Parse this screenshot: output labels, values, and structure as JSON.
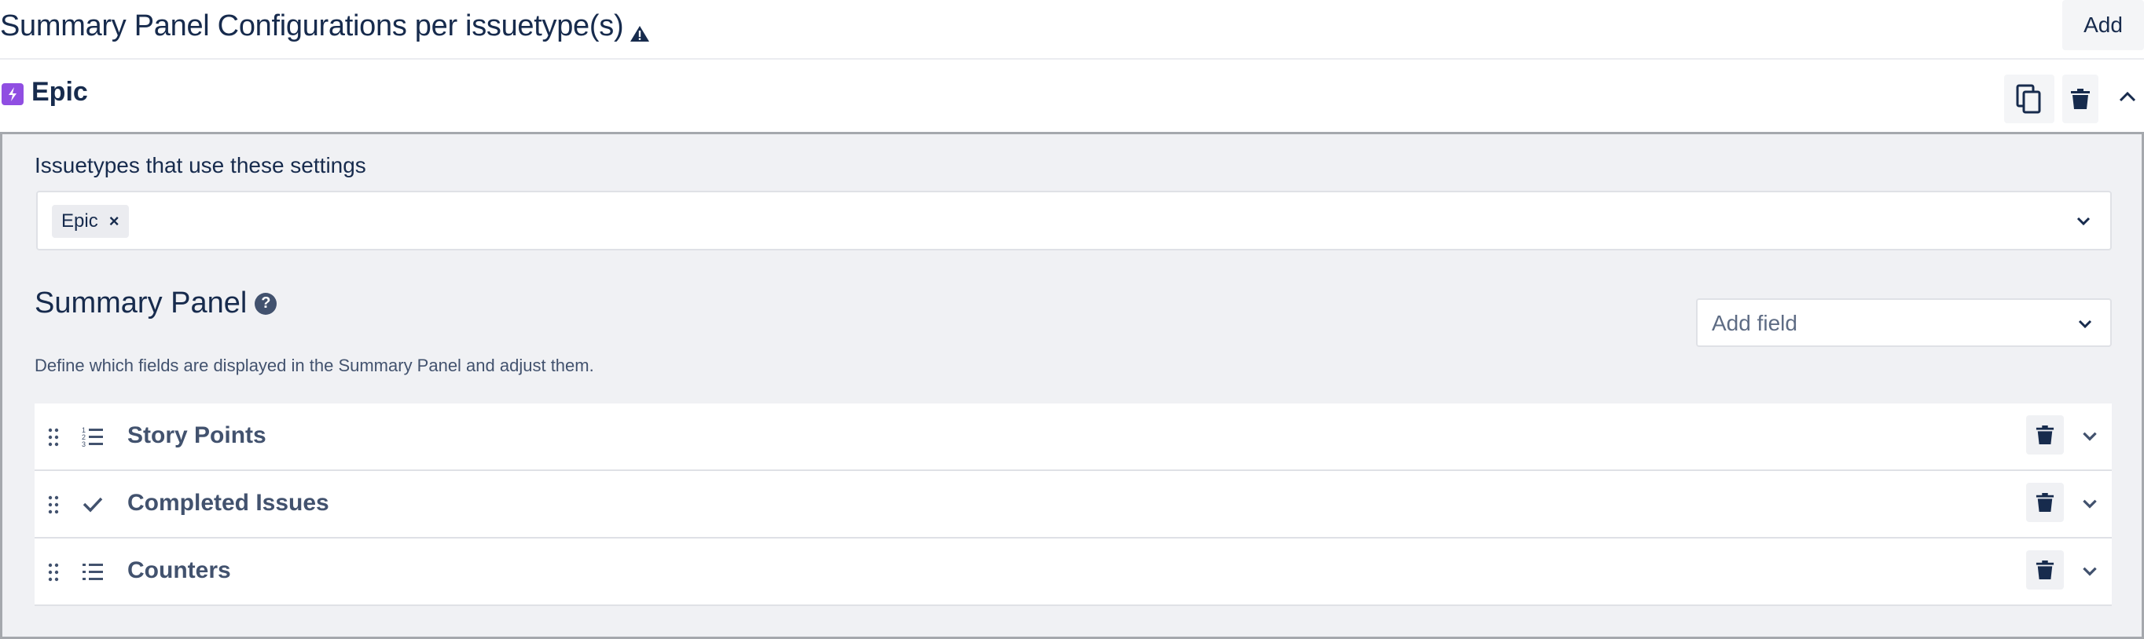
{
  "header": {
    "title": "Summary Panel Configurations per issuetype(s)",
    "add_label": "Add"
  },
  "epic": {
    "label": "Epic",
    "color": "#904ee2"
  },
  "issuetypes": {
    "label": "Issuetypes that use these settings",
    "selected": [
      "Epic"
    ]
  },
  "summary_panel": {
    "title": "Summary Panel",
    "description": "Define which fields are displayed in the Summary Panel and adjust them.",
    "add_field_placeholder": "Add field",
    "fields": [
      {
        "name": "Story Points",
        "icon": "numbered-list-icon"
      },
      {
        "name": "Completed Issues",
        "icon": "checkmark-icon"
      },
      {
        "name": "Counters",
        "icon": "list-icon"
      }
    ]
  },
  "colors": {
    "text": "#172b4d",
    "panel_bg": "#f0f1f4",
    "panel_border": "#a5a8ad",
    "epic_purple": "#904ee2"
  }
}
